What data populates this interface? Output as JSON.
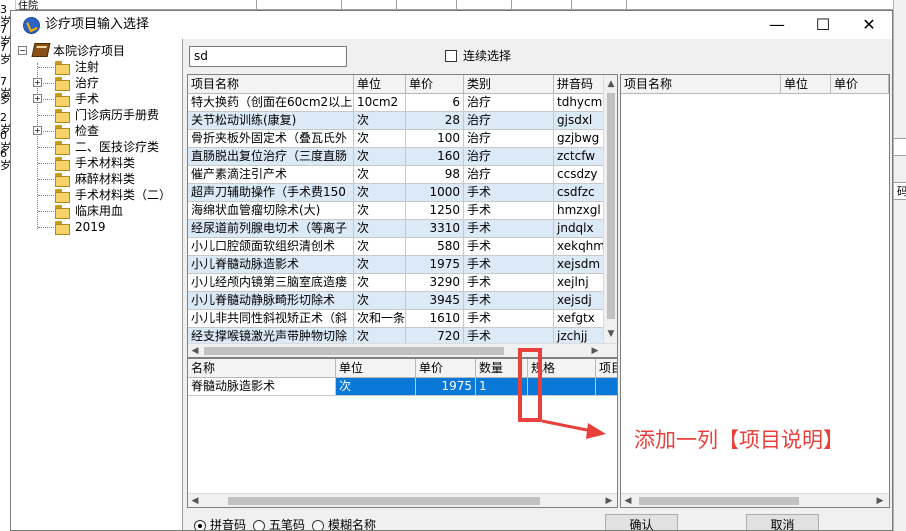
{
  "background_app": {
    "left_strip": [
      "3岁",
      "7岁",
      "7岁",
      "7岁",
      "岁",
      "2岁",
      "0岁",
      "6岁"
    ],
    "top_text": "住院",
    "right_strip": [
      "码"
    ]
  },
  "window": {
    "title": "诊疗项目输入选择",
    "minimize": "—",
    "maximize": "☐",
    "close": "✕"
  },
  "tree": {
    "root": "本院诊疗项目",
    "items": [
      {
        "label": "注射",
        "expandable": false
      },
      {
        "label": "治疗",
        "expandable": true
      },
      {
        "label": "手术",
        "expandable": true
      },
      {
        "label": "门诊病历手册费",
        "expandable": false
      },
      {
        "label": "检查",
        "expandable": true
      },
      {
        "label": "二、医技诊疗类",
        "expandable": false
      },
      {
        "label": "手术材料类",
        "expandable": false
      },
      {
        "label": "麻醉材料类",
        "expandable": false
      },
      {
        "label": "手术材料类（二）",
        "expandable": false
      },
      {
        "label": "临床用血",
        "expandable": false
      },
      {
        "label": "2019",
        "expandable": false
      }
    ]
  },
  "search": {
    "value": "sd"
  },
  "continuous_select": {
    "label": "连续选择",
    "checked": false
  },
  "main_grid": {
    "columns": [
      "项目名称",
      "单位",
      "单价",
      "类别",
      "拼音码"
    ],
    "rows": [
      [
        "特大换药（创面在60cm2以上",
        "10cm2",
        "6",
        "治疗",
        "tdhycm"
      ],
      [
        "关节松动训练(康复)",
        "次",
        "28",
        "治疗",
        "gjsdxl"
      ],
      [
        "骨折夹板外固定术（叠瓦氏外",
        "次",
        "100",
        "治疗",
        "gzjbwg"
      ],
      [
        "直肠脱出复位治疗（三度直肠",
        "次",
        "160",
        "治疗",
        "zctcfw"
      ],
      [
        "催产素滴注引产术",
        "次",
        "98",
        "治疗",
        "ccsdzy"
      ],
      [
        "超声刀辅助操作（手术费150",
        "次",
        "1000",
        "手术",
        "csdfzc"
      ],
      [
        "海绵状血管瘤切除术(大)",
        "次",
        "1250",
        "手术",
        "hmzxgl"
      ],
      [
        "经尿道前列腺电切术（等离子",
        "次",
        "3310",
        "手术",
        "jndqlx"
      ],
      [
        "小儿口腔颌面软组织清创术",
        "次",
        "580",
        "手术",
        "xekqhm"
      ],
      [
        "小儿脊髓动脉造影术",
        "次",
        "1975",
        "手术",
        "xejsdm"
      ],
      [
        "小儿经颅内镜第三脑室底造瘘",
        "次",
        "3290",
        "手术",
        "xejlnj"
      ],
      [
        "小儿脊髓动静脉畸形切除术",
        "次",
        "3945",
        "手术",
        "xejsdj"
      ],
      [
        "小儿非共同性斜视矫正术（斜",
        "次和一条",
        "1610",
        "手术",
        "xefgtx"
      ],
      [
        "经支撑喉镜激光声带肿物切除",
        "次",
        "720",
        "手术",
        "jzchjj"
      ]
    ]
  },
  "selected_grid": {
    "columns": [
      "名称",
      "单位",
      "单价",
      "数量",
      "规格",
      "项目"
    ],
    "rows": [
      [
        "脊髓动脉造影术",
        "次",
        "1975",
        "1",
        "",
        ""
      ]
    ]
  },
  "right_grid": {
    "columns": [
      "项目名称",
      "单位",
      "单价"
    ]
  },
  "search_mode": {
    "options": [
      "拼音码",
      "五笔码",
      "模糊名称"
    ],
    "selected": 0
  },
  "buttons": {
    "confirm": "确认",
    "cancel": "取消"
  },
  "annotation": {
    "text": "添加一列【项目说明】",
    "color": "#e8413c"
  }
}
